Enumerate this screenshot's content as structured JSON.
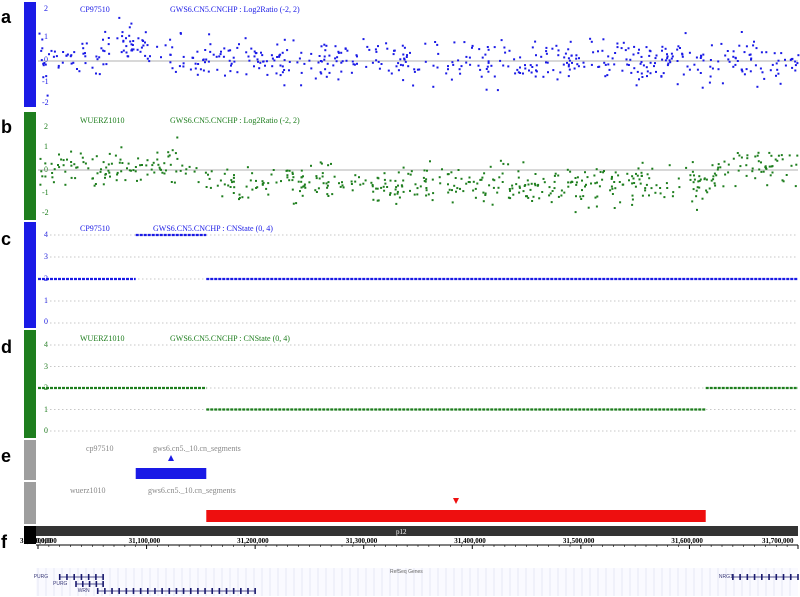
{
  "colors": {
    "blue": "#1a1ae6",
    "green": "#1e7e1e",
    "gray": "#9e9e9e",
    "red": "#ee0f0f",
    "ruler": "#333333"
  },
  "panels": {
    "a": {
      "letter": "a",
      "sample": "CP97510",
      "track": "GWS6.CN5.CNCHP : Log2Ratio (-2, 2)",
      "ticks": [
        "2",
        "1",
        "0",
        "-1",
        "-2"
      ],
      "chart_data": {
        "type": "scatter",
        "series_color": "blue",
        "ylim": [
          -2,
          2
        ],
        "x_range": [
          31000000,
          31700000
        ],
        "trend": [
          [
            31000000,
            0
          ],
          [
            31050000,
            0.1
          ],
          [
            31080000,
            0.55
          ],
          [
            31110000,
            0.45
          ],
          [
            31140000,
            0
          ],
          [
            31700000,
            0
          ]
        ]
      }
    },
    "b": {
      "letter": "b",
      "sample": "WUERZ1010",
      "track": "GWS6.CN5.CNCHP : Log2Ratio (-2, 2)",
      "ticks": [
        "2",
        "1",
        "0",
        "-1",
        "-2"
      ],
      "chart_data": {
        "type": "scatter",
        "series_color": "green",
        "ylim": [
          -2,
          2
        ],
        "x_range": [
          31000000,
          31700000
        ],
        "trend": [
          [
            31000000,
            0.1
          ],
          [
            31135000,
            0.1
          ],
          [
            31160000,
            -0.6
          ],
          [
            31610000,
            -0.6
          ],
          [
            31635000,
            0.15
          ],
          [
            31700000,
            0.15
          ]
        ]
      }
    },
    "c": {
      "letter": "c",
      "sample": "CP97510",
      "track": "GWS6.CN5.CNCHP : CNState (0, 4)",
      "ticks": [
        "4",
        "3",
        "2",
        "1",
        "0"
      ],
      "chart_data": {
        "type": "line",
        "series_color": "blue",
        "ylim": [
          0,
          4
        ],
        "segments": [
          {
            "start": 31000000,
            "end": 31090000,
            "state": 2
          },
          {
            "start": 31090000,
            "end": 31155000,
            "state": 4
          },
          {
            "start": 31155000,
            "end": 31700000,
            "state": 2
          }
        ]
      }
    },
    "d": {
      "letter": "d",
      "sample": "WUERZ1010",
      "track": "GWS6.CN5.CNCHP : CNState (0, 4)",
      "ticks": [
        "4",
        "3",
        "2",
        "1",
        "0"
      ],
      "chart_data": {
        "type": "line",
        "series_color": "green",
        "ylim": [
          0,
          4
        ],
        "segments": [
          {
            "start": 31000000,
            "end": 31155000,
            "state": 2
          },
          {
            "start": 31155000,
            "end": 31615000,
            "state": 1
          },
          {
            "start": 31615000,
            "end": 31700000,
            "state": 2
          }
        ]
      }
    },
    "e": {
      "letter": "e",
      "rows": [
        {
          "sample": "cp97510",
          "track": "gws6.cn5._10.cn_segments",
          "color": "blue",
          "start": 31090000,
          "end": 31155000,
          "marker": "up"
        },
        {
          "sample": "wuerz1010",
          "track": "gws6.cn5._10.cn_segments",
          "color": "red",
          "start": 31155000,
          "end": 31615000,
          "marker": "down"
        }
      ]
    },
    "f": {
      "letter": "f",
      "band": "p12",
      "ruler_labels": [
        "900,000",
        "31,000,000",
        "31,100,000",
        "31,200,000",
        "31,300,000",
        "31,400,000",
        "31,500,000",
        "31,600,000",
        "31,700,000"
      ],
      "ruler_positions": [
        31000000,
        31000000,
        31100000,
        31200000,
        31300000,
        31400000,
        31500000,
        31600000,
        31700000
      ],
      "refseq_label": "RefSeq Genes",
      "genes": [
        {
          "name": "PURG",
          "start": 31020000,
          "end": 31060000,
          "row": 0
        },
        {
          "name": "PURG",
          "start": 31035000,
          "end": 31060000,
          "row": 1
        },
        {
          "name": "WRN",
          "start": 31055000,
          "end": 31200000,
          "row": 2
        },
        {
          "name": "NRG1",
          "start": 31640000,
          "end": 31700000,
          "row": 0
        }
      ]
    }
  }
}
